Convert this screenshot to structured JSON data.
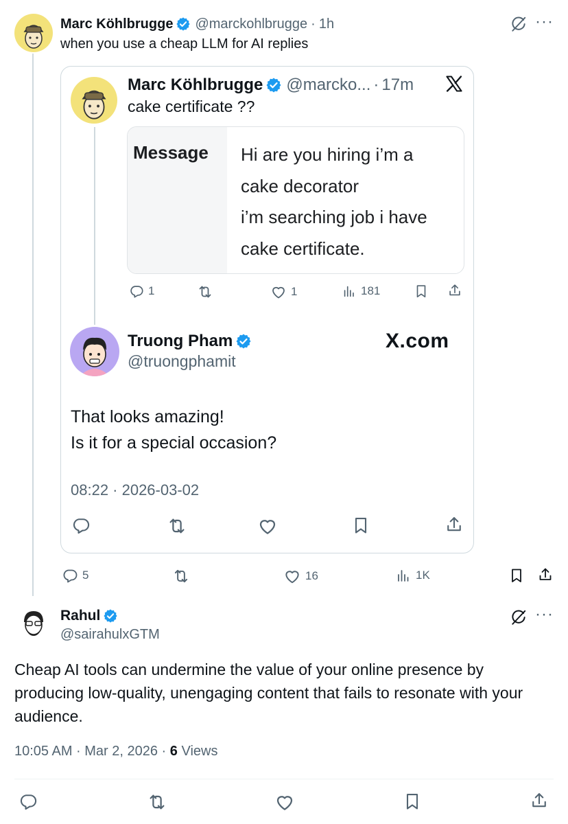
{
  "top_tweet": {
    "author": "Marc Köhlbrugge",
    "handle": "@marckohlbrugge",
    "time": "1h",
    "text": "when you use a cheap LLM for AI replies",
    "stats": {
      "replies": "5",
      "likes": "16",
      "views": "1K"
    }
  },
  "inner_tweet": {
    "author": "Marc Köhlbrugge",
    "handle": "@marcko...",
    "time": "17m",
    "text": "cake certificate ??",
    "message_label": "Message",
    "message_lines": [
      "Hi are you hiring i’m a",
      "cake decorator",
      "i’m searching job i have",
      "cake certificate."
    ],
    "stats": {
      "replies": "1",
      "likes": "1",
      "views": "181"
    }
  },
  "reply_card": {
    "author": "Truong Pham",
    "handle": "@truongphamit",
    "brand": "X.com",
    "text_lines": [
      "That looks amazing!",
      "Is it for a special occasion?"
    ],
    "timestamp": "08:22 · 2026-03-02"
  },
  "main_tweet": {
    "author": "Rahul",
    "handle": "@sairahulxGTM",
    "text": "Cheap AI tools can undermine the value of your online presence by producing low-quality, unengaging content that fails to resonate with your audience.",
    "time": "10:05 AM · Mar 2, 2026 · ",
    "views_count": "6",
    "views_label": " Views"
  },
  "icons": {
    "verified": "verified-badge-icon",
    "x_logo": "x-logo-icon",
    "grok": "grok-icon",
    "more": "more-icon",
    "reply": "reply-icon",
    "retweet": "retweet-icon",
    "like": "like-icon",
    "views": "views-icon",
    "bookmark": "bookmark-icon",
    "share": "share-icon"
  },
  "colors": {
    "verified": "#1d9bf0",
    "text": "#0f1419",
    "secondary": "#536471",
    "border": "#cfd9de"
  }
}
